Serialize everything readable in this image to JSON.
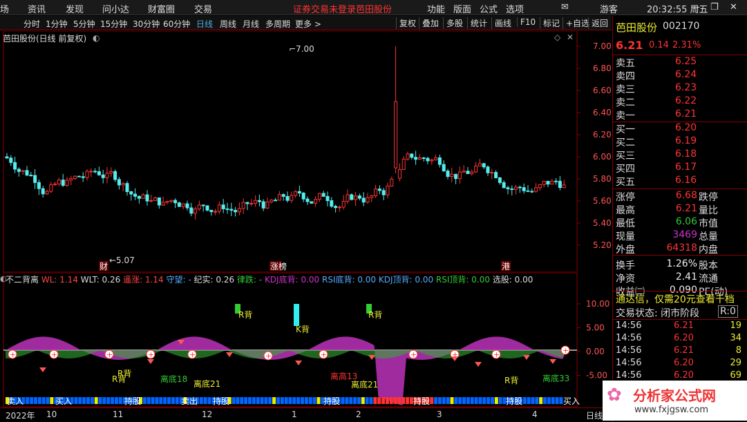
{
  "menu": {
    "items": [
      "场",
      "资讯",
      "发现",
      "问小达",
      "财富圈",
      "交易"
    ],
    "warning": "证券交易未登录",
    "stock_link": "芭田股份",
    "right_items": [
      "功能",
      "版面",
      "公式",
      "选项"
    ],
    "guest": "游客",
    "clock": "20:32:55 周五"
  },
  "periods": [
    "分时",
    "1分钟",
    "5分钟",
    "15分钟",
    "30分钟",
    "60分钟",
    "日线",
    "周线",
    "月线",
    "多周期",
    "更多 >"
  ],
  "tools": [
    "复权",
    "叠加",
    "多股",
    "统计",
    "画线",
    "F10",
    "标记",
    "+自选",
    "返回"
  ],
  "chart": {
    "title": "芭田股份(日线 前复权)",
    "yticks": [
      "7.00",
      "6.80",
      "6.60",
      "6.40",
      "6.20",
      "6.00",
      "5.80",
      "5.60",
      "5.40",
      "5.20"
    ],
    "high_label": "7.00",
    "low_label": "5.07",
    "markers": [
      "财",
      "涨榜",
      "港"
    ]
  },
  "indicator": {
    "name": "不二背离",
    "legend": [
      {
        "t": "WL: 1.14",
        "c": "#f44"
      },
      {
        "t": "WLT: 0.26",
        "c": "#ddd"
      },
      {
        "t": "遥涨: 1.14",
        "c": "#f44"
      },
      {
        "t": "守望: -",
        "c": "#5af"
      },
      {
        "t": "纪实: 0.26",
        "c": "#ddd"
      },
      {
        "t": "律跌: -",
        "c": "#3c3"
      },
      {
        "t": "KDJ底背: 0.00",
        "c": "#c3c"
      },
      {
        "t": "RSI底背: 0.00",
        "c": "#5af"
      },
      {
        "t": "KDJ顶背: 0.00",
        "c": "#5af"
      },
      {
        "t": "RSI顶背: 0.00",
        "c": "#3c3"
      },
      {
        "t": "选股: 0.00",
        "c": "#ddd"
      }
    ],
    "yticks": [
      "10.00",
      "5.00",
      "0.00",
      "-5.00"
    ],
    "labels": [
      "R背",
      "K背",
      "R背",
      "离底18",
      "离底21",
      "离高13",
      "离底21",
      "R背",
      "离底33",
      "R背",
      "R背"
    ],
    "bottom": [
      "卖入",
      "买入",
      "持股",
      "卖出",
      "持股",
      "持股",
      "持股",
      "持股",
      "买入"
    ]
  },
  "timeaxis": {
    "labels": [
      "2022年",
      "10",
      "11",
      "12",
      "1",
      "2",
      "3",
      "4"
    ],
    "mode": "日线"
  },
  "quote": {
    "name": "芭田股份",
    "code": "002170",
    "price": "6.21",
    "change": "0.14",
    "pct": "2.31%",
    "asks": [
      {
        "l": "卖五",
        "p": "6.25"
      },
      {
        "l": "卖四",
        "p": "6.24"
      },
      {
        "l": "卖三",
        "p": "6.23"
      },
      {
        "l": "卖二",
        "p": "6.22"
      },
      {
        "l": "卖一",
        "p": "6.21"
      }
    ],
    "bids": [
      {
        "l": "买一",
        "p": "6.20"
      },
      {
        "l": "买二",
        "p": "6.19"
      },
      {
        "l": "买三",
        "p": "6.18"
      },
      {
        "l": "买四",
        "p": "6.17"
      },
      {
        "l": "买五",
        "p": "6.16"
      }
    ],
    "stats": [
      {
        "l": "涨停",
        "v": "6.68",
        "c": "red",
        "r": "跌停"
      },
      {
        "l": "最高",
        "v": "6.21",
        "c": "red",
        "r": "量比"
      },
      {
        "l": "最低",
        "v": "6.06",
        "c": "grn",
        "r": "市值"
      },
      {
        "l": "现量",
        "v": "3469",
        "c": "mag",
        "r": "总量"
      },
      {
        "l": "外盘",
        "v": "64318",
        "c": "red",
        "r": "内盘"
      },
      {
        "l": "换手",
        "v": "1.26%",
        "c": "wht",
        "r": "股本"
      },
      {
        "l": "净资",
        "v": "2.41",
        "c": "wht",
        "r": "流通"
      },
      {
        "l": "收益㈢",
        "v": "0.090",
        "c": "wht",
        "r": "PE(动)"
      }
    ],
    "ad": "通达信，仅需20元查看千档",
    "status": "交易状态: 闭市阶段",
    "status_btn": "R:0",
    "ticks": [
      {
        "t": "14:56",
        "p": "6.21",
        "v": "19"
      },
      {
        "t": "14:56",
        "p": "6.20",
        "v": "34"
      },
      {
        "t": "14:56",
        "p": "6.21",
        "v": "8"
      },
      {
        "t": "14:56",
        "p": "6.20",
        "v": "29"
      },
      {
        "t": "14:56",
        "p": "6.20",
        "v": "69"
      }
    ]
  },
  "watermark": {
    "text": "分析家公式网",
    "url": "www.fxjgsw.com"
  },
  "colors": {
    "up": "#f33",
    "down": "#5ee",
    "grid": "#800"
  }
}
